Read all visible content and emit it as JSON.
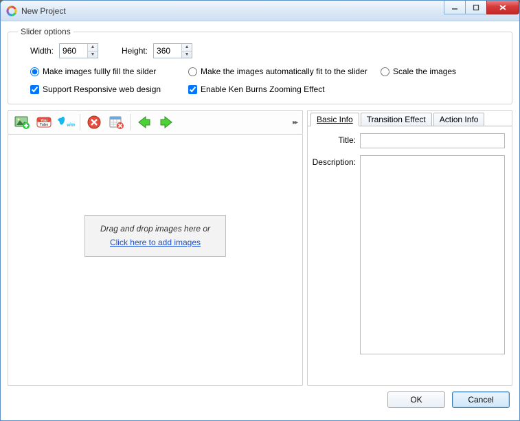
{
  "window": {
    "title": "New Project"
  },
  "slider_options": {
    "legend": "Slider options",
    "width_label": "Width:",
    "width_value": "960",
    "height_label": "Height:",
    "height_value": "360",
    "fit_mode": {
      "fill": "Make images fullly fill the silder",
      "auto": "Make the images automatically fit to the slider",
      "scale": "Scale the images"
    },
    "support_responsive": "Support Responsive web design",
    "ken_burns": "Enable Ken Burns Zooming Effect"
  },
  "toolbar": {
    "icons": {
      "add_image": "add-image-icon",
      "youtube": "youtube-icon",
      "vimeo": "vimeo-icon",
      "delete": "delete-icon",
      "calendar": "calendar-delete-icon",
      "prev": "arrow-left-icon",
      "next": "arrow-right-icon",
      "overflow": "overflow-icon"
    }
  },
  "drop_hint": {
    "line1": "Drag and drop images here or",
    "link": "Click here to add images"
  },
  "tabs": {
    "basic": "Basic Info",
    "transition": "Transition Effect",
    "action": "Action Info"
  },
  "basic_info": {
    "title_label": "Title:",
    "title_value": "",
    "description_label": "Description:",
    "description_value": ""
  },
  "footer": {
    "ok": "OK",
    "cancel": "Cancel"
  }
}
